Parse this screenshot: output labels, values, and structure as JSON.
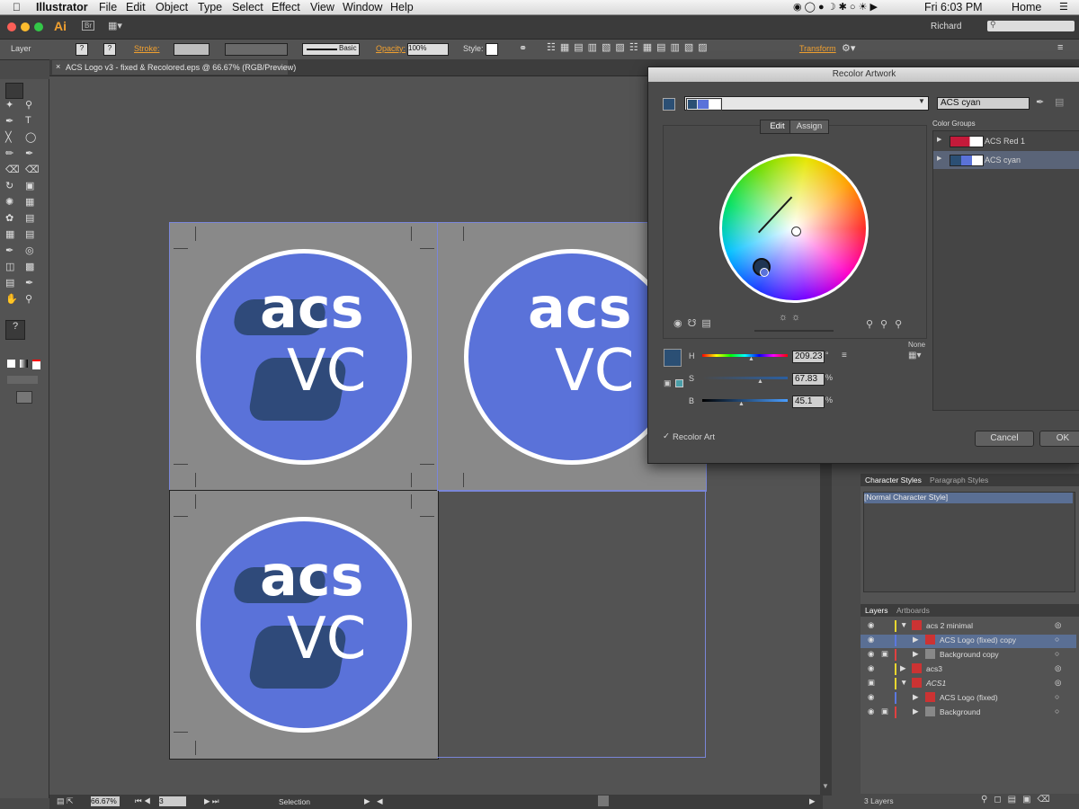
{
  "menubar": {
    "app": "Illustrator",
    "items": [
      "File",
      "Edit",
      "Object",
      "Type",
      "Select",
      "Effect",
      "View",
      "Window",
      "Help"
    ],
    "clock": "Fri 6:03 PM",
    "home": "Home"
  },
  "appbar": {
    "ai_logo": "Ai",
    "br": "Br",
    "user": "Richard"
  },
  "control": {
    "selection_type": "Layer",
    "stroke_label": "Stroke:",
    "brush": "Basic",
    "opacity_label": "Opacity:",
    "opacity_value": "100%",
    "style_label": "Style:",
    "transform_label": "Transform"
  },
  "document": {
    "tab_title": "ACS Logo v3 - fixed & Recolored.eps @ 66.67% (RGB/Preview)"
  },
  "artwork": {
    "word1": "acs",
    "word2": "VC"
  },
  "dialog": {
    "title": "Recolor Artwork",
    "color_group_name": "ACS cyan",
    "tab_edit": "Edit",
    "tab_assign": "Assign",
    "groups_header": "Color Groups",
    "groups": [
      "ACS Red 1",
      "ACS cyan"
    ],
    "h_label": "H",
    "h_value": "209.23",
    "h_unit": "°",
    "s_label": "S",
    "s_value": "67.83",
    "s_unit": "%",
    "b_label": "B",
    "b_value": "45.1",
    "b_unit": "%",
    "none_label": "None",
    "recolor_art": "Recolor Art",
    "cancel": "Cancel",
    "ok": "OK",
    "swatch_color": "#2b4f74"
  },
  "char_styles": {
    "tab1": "Character Styles",
    "tab2": "Paragraph Styles",
    "item": "[Normal Character Style]"
  },
  "layers": {
    "tab1": "Layers",
    "tab2": "Artboards",
    "rows": [
      "acs 2 minimal",
      "ACS Logo (fixed) copy",
      "Background copy",
      "acs3",
      "ACS1",
      "ACS Logo (fixed)",
      "Background"
    ],
    "footer": "3 Layers"
  },
  "status": {
    "zoom": "66.67%",
    "page": "3",
    "tool": "Selection"
  }
}
